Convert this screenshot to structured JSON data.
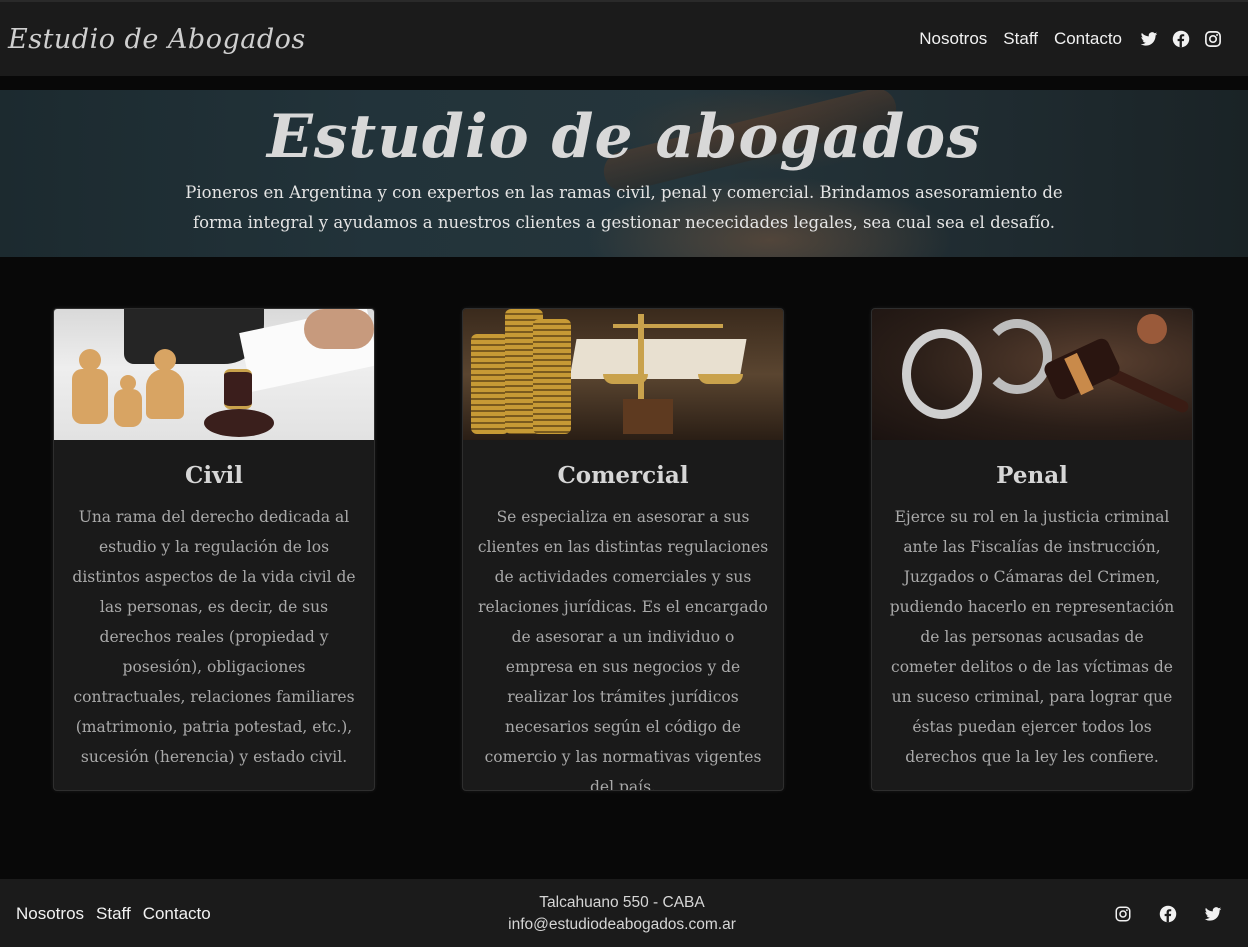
{
  "navbar": {
    "brand": "Estudio de Abogados",
    "links": [
      "Nosotros",
      "Staff",
      "Contacto"
    ],
    "icons": [
      "twitter-icon",
      "facebook-icon",
      "instagram-icon"
    ]
  },
  "hero": {
    "title": "Estudio de abogados",
    "text": "Pioneros en Argentina y con expertos en las ramas civil, penal y comercial. Brindamos asesoramiento de forma integral y ayudamos a nuestros clientes a gestionar nececidades legales, sea cual sea el desafío."
  },
  "cards": [
    {
      "title": "Civil",
      "text": "Una rama del derecho dedicada al estudio y la regulación de los distintos aspectos de la vida civil de las personas, es decir, de sus derechos reales (propiedad y posesión), obligaciones contractuales, relaciones familiares (matrimonio, patria potestad, etc.), sucesión (herencia) y estado civil."
    },
    {
      "title": "Comercial",
      "text": "Se especializa en asesorar a sus clientes en las distintas regulaciones de actividades comerciales y sus relaciones jurídicas. Es el encargado de asesorar a un individuo o empresa en sus negocios y de realizar los trámites jurídicos necesarios según el código de comercio y las normativas vigentes del país."
    },
    {
      "title": "Penal",
      "text": "Ejerce su rol en la justicia criminal ante las Fiscalías de instrucción, Juzgados o Cámaras del Crimen, pudiendo hacerlo en representación de las personas acusadas de cometer delitos o de las víctimas de un suceso criminal, para lograr que éstas puedan ejercer todos los derechos que la ley les confiere."
    }
  ],
  "footer": {
    "links": [
      "Nosotros",
      "Staff",
      "Contacto"
    ],
    "address": "Talcahuano 550 - CABA",
    "email": "info@estudiodeabogados.com.ar",
    "icons": [
      "instagram-icon",
      "facebook-icon",
      "twitter-icon"
    ]
  },
  "colors": {
    "background": "#080808",
    "navbar": "#1b1b1b",
    "card": "#1a1a1a",
    "text": "#c9c9c9"
  }
}
